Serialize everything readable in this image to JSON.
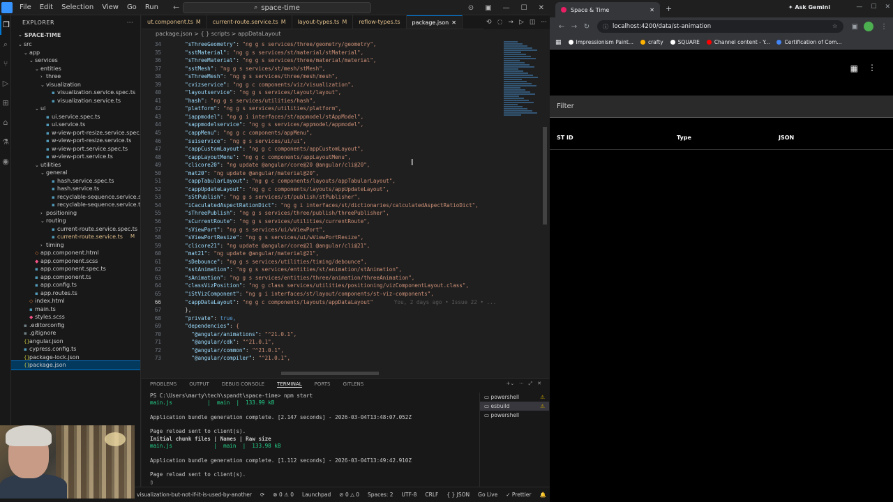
{
  "vscode": {
    "menu": [
      "File",
      "Edit",
      "Selection",
      "View",
      "Go",
      "Run"
    ],
    "search_title": "space-time",
    "explorer_label": "EXPLORER",
    "project_name": "SPACE-TIME",
    "tree": [
      {
        "indent": 0,
        "type": "folder",
        "open": true,
        "name": "src"
      },
      {
        "indent": 1,
        "type": "folder",
        "open": true,
        "name": "app"
      },
      {
        "indent": 2,
        "type": "folder",
        "open": true,
        "name": "services"
      },
      {
        "indent": 3,
        "type": "folder",
        "open": true,
        "name": "entities"
      },
      {
        "indent": 4,
        "type": "folder",
        "open": false,
        "name": "three"
      },
      {
        "indent": 4,
        "type": "folder",
        "open": true,
        "name": "visualization"
      },
      {
        "indent": 5,
        "type": "file",
        "name": "visualization.service.spec.ts"
      },
      {
        "indent": 5,
        "type": "file",
        "name": "visualization.service.ts"
      },
      {
        "indent": 3,
        "type": "folder",
        "open": true,
        "name": "ui"
      },
      {
        "indent": 4,
        "type": "file",
        "name": "ui.service.spec.ts"
      },
      {
        "indent": 4,
        "type": "file",
        "name": "ui.service.ts"
      },
      {
        "indent": 4,
        "type": "file",
        "name": "w-view-port-resize.service.spec.ts"
      },
      {
        "indent": 4,
        "type": "file",
        "name": "w-view-port-resize.service.ts"
      },
      {
        "indent": 4,
        "type": "file",
        "name": "w-view-port.service.spec.ts"
      },
      {
        "indent": 4,
        "type": "file",
        "name": "w-view-port.service.ts"
      },
      {
        "indent": 3,
        "type": "folder",
        "open": true,
        "name": "utilities"
      },
      {
        "indent": 4,
        "type": "folder",
        "open": true,
        "name": "general"
      },
      {
        "indent": 5,
        "type": "file",
        "name": "hash.service.spec.ts"
      },
      {
        "indent": 5,
        "type": "file",
        "name": "hash.service.ts"
      },
      {
        "indent": 5,
        "type": "file",
        "name": "recyclable-sequence.service.spec.ts"
      },
      {
        "indent": 5,
        "type": "file",
        "name": "recyclable-sequence.service.ts"
      },
      {
        "indent": 4,
        "type": "folder",
        "open": false,
        "name": "positioning"
      },
      {
        "indent": 4,
        "type": "folder",
        "open": true,
        "name": "routing"
      },
      {
        "indent": 5,
        "type": "file",
        "name": "current-route.service.spec.ts"
      },
      {
        "indent": 5,
        "type": "file",
        "name": "current-route.service.ts",
        "badge": "M"
      },
      {
        "indent": 4,
        "type": "folder",
        "open": false,
        "name": "timing"
      },
      {
        "indent": 2,
        "type": "file",
        "name": "app.component.html"
      },
      {
        "indent": 2,
        "type": "file",
        "name": "app.component.scss"
      },
      {
        "indent": 2,
        "type": "file",
        "name": "app.component.spec.ts"
      },
      {
        "indent": 2,
        "type": "file",
        "name": "app.component.ts"
      },
      {
        "indent": 2,
        "type": "file",
        "name": "app.config.ts"
      },
      {
        "indent": 2,
        "type": "file",
        "name": "app.routes.ts"
      },
      {
        "indent": 1,
        "type": "file",
        "name": "index.html"
      },
      {
        "indent": 1,
        "type": "file",
        "name": "main.ts"
      },
      {
        "indent": 1,
        "type": "file",
        "name": "styles.scss"
      },
      {
        "indent": 0,
        "type": "file",
        "name": ".editorconfig"
      },
      {
        "indent": 0,
        "type": "file",
        "name": ".gitignore"
      },
      {
        "indent": 0,
        "type": "file",
        "name": "angular.json"
      },
      {
        "indent": 0,
        "type": "file",
        "name": "cypress.config.ts"
      },
      {
        "indent": 0,
        "type": "file",
        "name": "package-lock.json"
      },
      {
        "indent": 0,
        "type": "file",
        "name": "package.json",
        "current": true
      }
    ],
    "tabs": [
      {
        "label": "ut.component.ts",
        "badge": "M"
      },
      {
        "label": "current-route.service.ts",
        "badge": "M"
      },
      {
        "label": "layout-types.ts",
        "badge": "M"
      },
      {
        "label": "reflow-types.ts",
        "badge": ""
      },
      {
        "label": "package.json",
        "badge": "",
        "active": true
      }
    ],
    "breadcrumb": "package.json > { } scripts > appDataLayout",
    "code_lines": [
      {
        "n": "34",
        "k": "\"sThreeGeometry\"",
        "v": "\"ng g s services/three/geometry/geometry\","
      },
      {
        "n": "35",
        "k": "\"sstMaterial\"",
        "v": "\"ng g s services/st/material/stMaterial\","
      },
      {
        "n": "36",
        "k": "\"sThreeMaterial\"",
        "v": "\"ng g s services/three/material/material\","
      },
      {
        "n": "37",
        "k": "\"sstMesh\"",
        "v": "\"ng g s services/st/mesh/stMesh\","
      },
      {
        "n": "38",
        "k": "\"sThreeMesh\"",
        "v": "\"ng g s services/three/mesh/mesh\","
      },
      {
        "n": "39",
        "k": "\"cvizservice\"",
        "v": "\"ng g c components/viz/visualization\","
      },
      {
        "n": "40",
        "k": "\"layoutservice\"",
        "v": "\"ng g s services/layout/layout\","
      },
      {
        "n": "41",
        "k": "\"hash\"",
        "v": "\"ng g s services/utilities/hash\","
      },
      {
        "n": "42",
        "k": "\"platform\"",
        "v": "\"ng g s services/utilities/platform\","
      },
      {
        "n": "43",
        "k": "\"iappmodel\"",
        "v": "\"ng g i interfaces/st/appmodel/stAppModel\","
      },
      {
        "n": "44",
        "k": "\"sappmodelservice\"",
        "v": "\"ng g s services/appmodel/appmodel\","
      },
      {
        "n": "45",
        "k": "\"cappMenu\"",
        "v": "\"ng g c components/appMenu\","
      },
      {
        "n": "46",
        "k": "\"suiservice\"",
        "v": "\"ng g s services/ui/ui\","
      },
      {
        "n": "47",
        "k": "\"cappCustomLayout\"",
        "v": "\"ng g c components/appCustomLayout\","
      },
      {
        "n": "48",
        "k": "\"cappLayoutMenu\"",
        "v": "\"ng g c components/appLayoutMenu\","
      },
      {
        "n": "49",
        "k": "\"clicore20\"",
        "v": "\"ng update @angular/core@20 @angular/cli@20\","
      },
      {
        "n": "50",
        "k": "\"mat20\"",
        "v": "\"ng update @angular/material@20\","
      },
      {
        "n": "51",
        "k": "\"cappTabularLayout\"",
        "v": "\"ng g c components/layouts/appTabularLayout\","
      },
      {
        "n": "52",
        "k": "\"cappUpdateLayout\"",
        "v": "\"ng g c components/layouts/appUpdateLayout\","
      },
      {
        "n": "53",
        "k": "\"sStPublish\"",
        "v": "\"ng g s services/st/publish/stPublisher\","
      },
      {
        "n": "54",
        "k": "\"iCaculatedAspectRationDict\"",
        "v": "\"ng g i interfaces/st/dictionaries/calculatedAspectRatioDict\","
      },
      {
        "n": "55",
        "k": "\"sThreePublish\"",
        "v": "\"ng g s services/three/publish/threePublisher\","
      },
      {
        "n": "56",
        "k": "\"sCurrentRoute\"",
        "v": "\"ng g s services/utilities/currentRoute\","
      },
      {
        "n": "57",
        "k": "\"sViewPort\"",
        "v": "\"ng g s services/ui/wViewPort\","
      },
      {
        "n": "58",
        "k": "\"sViewPortResize\"",
        "v": "\"ng g s services/ui/wViewPortResize\","
      },
      {
        "n": "59",
        "k": "\"clicore21\"",
        "v": "\"ng update @angular/core@21 @angular/cli@21\","
      },
      {
        "n": "60",
        "k": "\"mat21\"",
        "v": "\"ng update @angular/material@21\","
      },
      {
        "n": "61",
        "k": "\"sDebounce\"",
        "v": "\"ng g s services/utilities/timing/debounce\","
      },
      {
        "n": "62",
        "k": "\"sstAnimation\"",
        "v": "\"ng g s services/entities/st/animation/stAnimation\","
      },
      {
        "n": "63",
        "k": "\"sAnimation\"",
        "v": "\"ng g s services/entities/three/animation/threeAnimation\","
      },
      {
        "n": "64",
        "k": "\"classVizPosition\"",
        "v": "\"ng g class services/utilities/positioning/vizComponentLayout.class\","
      },
      {
        "n": "65",
        "k": "\"iStVizComponent\"",
        "v": "\"ng g i interfaces/st/layout/components/st-viz-components\","
      },
      {
        "n": "66",
        "k": "\"cappDataLayout\"",
        "v": "\"ng g c components/layouts/appDataLayout\"",
        "current": true,
        "blame": "You, 2 days ago • Issue 22 • ..."
      },
      {
        "n": "67",
        "raw": "},"
      },
      {
        "n": "68",
        "k": "\"private\"",
        "v": "true,",
        "kwval": true
      },
      {
        "n": "69",
        "k": "\"dependencies\"",
        "v": "{"
      },
      {
        "n": "70",
        "k": "\"@angular/animations\"",
        "v": "\"^21.0.1\",",
        "indent": 1
      },
      {
        "n": "71",
        "k": "\"@angular/cdk\"",
        "v": "\"^21.0.1\",",
        "indent": 1
      },
      {
        "n": "72",
        "k": "\"@angular/common\"",
        "v": "\"^21.0.1\",",
        "indent": 1
      },
      {
        "n": "73",
        "k": "\"@angular/compiler\"",
        "v": "\"^21.0.1\",",
        "indent": 1
      }
    ],
    "panel_tabs": [
      "PROBLEMS",
      "OUTPUT",
      "DEBUG CONSOLE",
      "TERMINAL",
      "PORTS",
      "GITLENS"
    ],
    "panel_active": "TERMINAL",
    "terminal_lines": [
      {
        "cls": "",
        "t": "PS C:\\Users\\marty\\tech\\spandt\\space-time> npm start"
      },
      {
        "cls": "g",
        "t": "main.js           |  main  |  133.99 kB"
      },
      {
        "cls": "",
        "t": ""
      },
      {
        "cls": "",
        "t": "Application bundle generation complete. [2.147 seconds] - 2026-03-04T13:48:07.052Z"
      },
      {
        "cls": "",
        "t": ""
      },
      {
        "cls": "",
        "t": "Page reload sent to client(s)."
      },
      {
        "cls": "b",
        "t": "Initial chunk files | Names | Raw size"
      },
      {
        "cls": "g",
        "t": "main.js             |  main  |  133.98 kB"
      },
      {
        "cls": "",
        "t": ""
      },
      {
        "cls": "",
        "t": "Application bundle generation complete. [1.112 seconds] - 2026-03-04T13:49:42.910Z"
      },
      {
        "cls": "",
        "t": ""
      },
      {
        "cls": "",
        "t": "Page reload sent to client(s)."
      },
      {
        "cls": "",
        "t": "▯"
      }
    ],
    "terminals": [
      {
        "name": "powershell",
        "warn": true
      },
      {
        "name": "esbuild",
        "warn": true,
        "active": true
      },
      {
        "name": "powershell",
        "warn": false
      }
    ],
    "status": {
      "branch": "visualization-but-not-if-it-is-used-by-another",
      "errors": "⊗ 0 ⚠ 0",
      "launchpad": "Launchpad",
      "spaces": "Spaces: 2",
      "encoding": "UTF-8",
      "eol": "CRLF",
      "lang": "{ } JSON",
      "golive": "Go Live",
      "prettier": "✓ Prettier"
    }
  },
  "browser": {
    "tab_title": "Space & Time",
    "ask_gemini": "Ask Gemini",
    "url": "localhost:4200/data/st-animation",
    "bookmarks": [
      {
        "label": "Impressionism Paint...",
        "color": "#ffffff"
      },
      {
        "label": "crafty",
        "color": "#ffb300"
      },
      {
        "label": "SQUARE",
        "color": "#ffffff"
      },
      {
        "label": "Channel content - Y...",
        "color": "#ff0000"
      },
      {
        "label": "Certification of Com...",
        "color": "#4285f4"
      }
    ],
    "filter_label": "Filter",
    "columns": [
      "ST ID",
      "Type",
      "JSON"
    ]
  }
}
